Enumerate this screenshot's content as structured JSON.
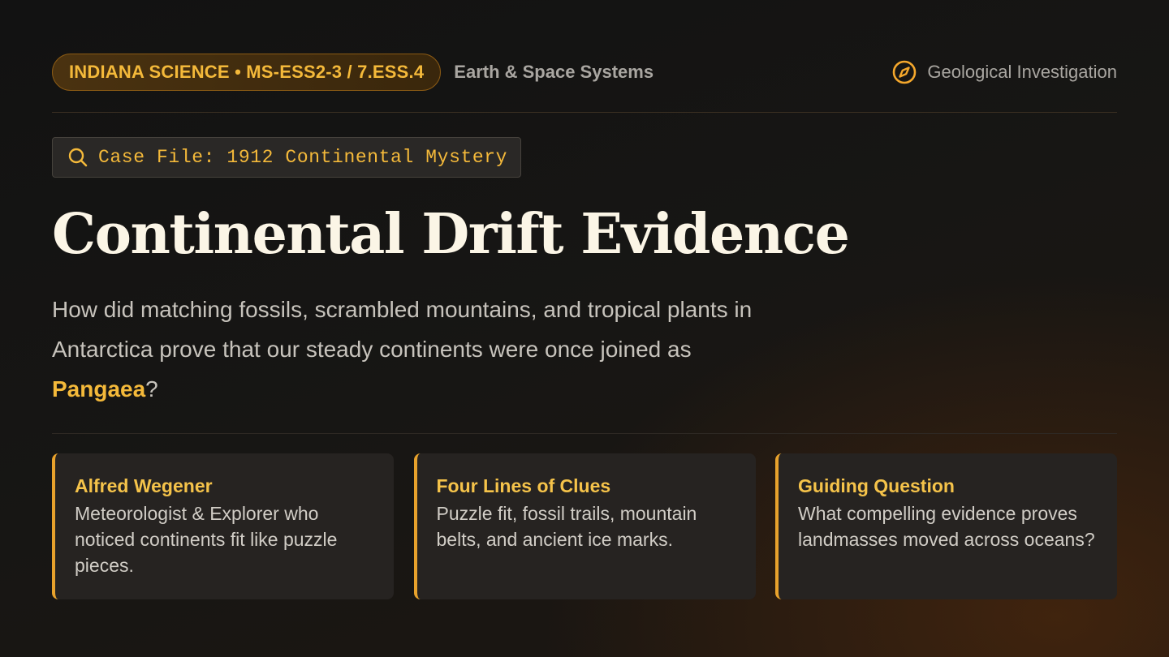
{
  "header": {
    "standard": "INDIANA SCIENCE • MS-ESS2-3 / 7.ESS.4",
    "subject": "Earth & Space Systems",
    "investigation": "Geological Investigation",
    "icon": "compass-icon"
  },
  "case_file": {
    "icon": "search-icon",
    "label": "Case File: 1912 Continental Mystery"
  },
  "title": "Continental Drift Evidence",
  "intro": {
    "text_before": "How did matching fossils, scrambled mountains, and tropical plants in Antarctica prove that our steady continents were once joined as ",
    "highlight": "Pangaea",
    "text_after": "?"
  },
  "cards": [
    {
      "title": "Alfred Wegener",
      "text": "Meteorologist & Explorer who noticed continents fit like puzzle pieces."
    },
    {
      "title": "Four Lines of Clues",
      "text": "Puzzle fit, fossil trails, mountain belts, and ancient ice marks."
    },
    {
      "title": "Guiding Question",
      "text": "What compelling evidence proves landmasses moved across oceans?"
    }
  ],
  "colors": {
    "accent": "#f4b93a",
    "card_border": "#e8a22c",
    "title": "#fbf5e6"
  }
}
